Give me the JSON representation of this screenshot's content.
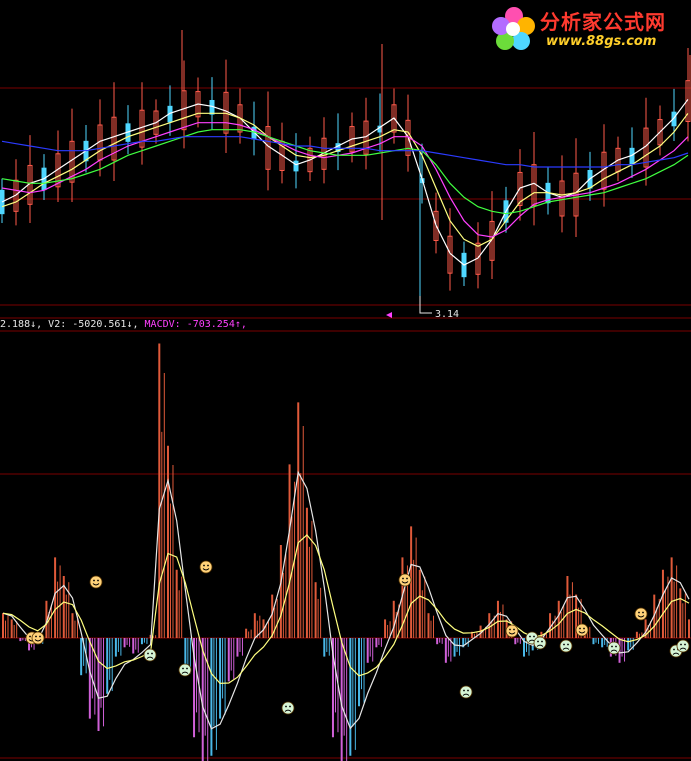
{
  "logo": {
    "title": "分析家公式网",
    "url": "www.88gs.com"
  },
  "price_panel": {
    "low_marker": "3.14"
  },
  "readout": {
    "item1": "2.188↓",
    "sep1": ", ",
    "v2_label": "V2: ",
    "v2_value": "-5020.561↓",
    "sep2": ", ",
    "macdv_label": "MACDV: ",
    "macdv_value": "-703.254↑",
    "sep3": ","
  },
  "colors": {
    "background": "#000000",
    "grid": "#7a0000",
    "up": "#ff5a4a",
    "down": "#4fd7ff",
    "ma_white": "#ffffff",
    "ma_yellow": "#ffff80",
    "ma_magenta": "#ff40ff",
    "ma_green": "#40ff40",
    "ma_blue": "#2b3bff",
    "hist_pos": "#e05a3a",
    "hist_neg_blue": "#4ab8e8",
    "hist_neg_magenta": "#d060d8",
    "readout_white": "#e6e6e6",
    "readout_green": "#30ff30",
    "readout_magenta": "#ff40ff"
  },
  "chart_data": [
    {
      "type": "candlestick",
      "title": "",
      "series": [
        {
          "color": "#ffffff",
          "values": [
            3.52,
            3.55,
            3.6,
            3.62,
            3.66,
            3.7,
            3.74,
            3.78,
            3.8,
            3.82,
            3.84,
            3.86,
            3.9,
            3.92,
            3.94,
            3.93,
            3.91,
            3.88,
            3.82,
            3.76,
            3.72,
            3.68,
            3.7,
            3.73,
            3.76,
            3.79,
            3.8,
            3.84,
            3.88,
            3.8,
            3.62,
            3.42,
            3.3,
            3.25,
            3.28,
            3.36,
            3.48,
            3.58,
            3.6,
            3.56,
            3.54,
            3.56,
            3.62,
            3.66,
            3.7,
            3.72,
            3.76,
            3.82,
            3.88,
            3.96
          ]
        },
        {
          "color": "#ffff80",
          "values": [
            3.5,
            3.52,
            3.56,
            3.6,
            3.63,
            3.66,
            3.7,
            3.74,
            3.77,
            3.8,
            3.82,
            3.84,
            3.86,
            3.88,
            3.9,
            3.9,
            3.9,
            3.88,
            3.85,
            3.8,
            3.76,
            3.72,
            3.71,
            3.72,
            3.74,
            3.76,
            3.78,
            3.8,
            3.83,
            3.82,
            3.72,
            3.58,
            3.44,
            3.36,
            3.33,
            3.36,
            3.44,
            3.52,
            3.56,
            3.56,
            3.55,
            3.56,
            3.58,
            3.62,
            3.65,
            3.68,
            3.72,
            3.76,
            3.82,
            3.9
          ]
        },
        {
          "color": "#ff40ff",
          "values": [
            3.58,
            3.57,
            3.56,
            3.57,
            3.6,
            3.63,
            3.66,
            3.7,
            3.73,
            3.76,
            3.78,
            3.8,
            3.82,
            3.84,
            3.86,
            3.86,
            3.86,
            3.85,
            3.83,
            3.8,
            3.77,
            3.74,
            3.72,
            3.71,
            3.72,
            3.73,
            3.75,
            3.77,
            3.8,
            3.8,
            3.76,
            3.66,
            3.54,
            3.44,
            3.38,
            3.37,
            3.4,
            3.46,
            3.51,
            3.53,
            3.54,
            3.55,
            3.56,
            3.58,
            3.6,
            3.63,
            3.66,
            3.7,
            3.74,
            3.8
          ]
        },
        {
          "color": "#40ff40",
          "values": [
            3.62,
            3.61,
            3.6,
            3.6,
            3.61,
            3.62,
            3.64,
            3.66,
            3.69,
            3.72,
            3.74,
            3.76,
            3.78,
            3.8,
            3.82,
            3.83,
            3.83,
            3.83,
            3.82,
            3.8,
            3.78,
            3.76,
            3.74,
            3.73,
            3.72,
            3.72,
            3.72,
            3.73,
            3.74,
            3.75,
            3.74,
            3.68,
            3.6,
            3.54,
            3.5,
            3.48,
            3.47,
            3.48,
            3.5,
            3.52,
            3.53,
            3.54,
            3.55,
            3.56,
            3.58,
            3.6,
            3.62,
            3.65,
            3.68,
            3.72
          ]
        },
        {
          "color": "#2b3bff",
          "values": [
            3.78,
            3.77,
            3.76,
            3.75,
            3.74,
            3.74,
            3.74,
            3.75,
            3.76,
            3.77,
            3.78,
            3.78,
            3.79,
            3.8,
            3.8,
            3.8,
            3.8,
            3.8,
            3.79,
            3.78,
            3.77,
            3.76,
            3.76,
            3.75,
            3.75,
            3.75,
            3.75,
            3.74,
            3.74,
            3.74,
            3.74,
            3.73,
            3.72,
            3.71,
            3.7,
            3.69,
            3.68,
            3.68,
            3.67,
            3.67,
            3.67,
            3.67,
            3.67,
            3.67,
            3.68,
            3.68,
            3.69,
            3.7,
            3.71,
            3.73
          ]
        }
      ]
    },
    {
      "type": "bar",
      "title": "",
      "series": [
        {
          "name": "V2",
          "values": [
            80,
            60,
            -10,
            -40,
            -20,
            120,
            260,
            200,
            80,
            -120,
            -260,
            -300,
            -180,
            -60,
            -30,
            -50,
            -20,
            10,
            950,
            620,
            220,
            -120,
            -320,
            -420,
            -380,
            -260,
            -140,
            -60,
            30,
            80,
            60,
            140,
            300,
            560,
            760,
            420,
            180,
            -60,
            -320,
            -420,
            -380,
            -220,
            -80,
            -30,
            60,
            120,
            260,
            360,
            220,
            80,
            -20,
            -80,
            -60,
            -30,
            20,
            40,
            80,
            120,
            60,
            -20,
            -60,
            -40,
            20,
            80,
            120,
            200,
            140,
            40,
            -20,
            -30,
            -60,
            -80,
            -40,
            20,
            60,
            140,
            220,
            260,
            160,
            60
          ]
        }
      ]
    }
  ]
}
